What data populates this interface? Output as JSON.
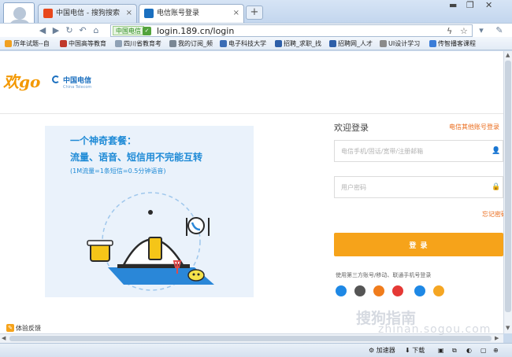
{
  "browser": {
    "tabs": [
      {
        "label": "中国电信 - 搜狗搜索",
        "active": false
      },
      {
        "label": "电信账号登录",
        "active": true
      }
    ],
    "new_tab": "+",
    "address": "login.189.cn/login",
    "cert_label": "中国电信",
    "bookmarks": [
      "历年试题--自",
      "中国高等教育",
      "四川省教育考",
      "我的订阅_频",
      "电子科技大学",
      "招聘_求职_找",
      "招聘网_人才",
      "UI设计学习",
      "传智播客课程"
    ],
    "status": {
      "accelerator": "加速器",
      "download": "下载"
    }
  },
  "page": {
    "logo": "欢go",
    "telecom_logo": "中国电信",
    "telecom_sub": "China Telecom",
    "banner": {
      "line1": "一个神奇套餐：",
      "line2": "流量、语音、短信用不完能互转",
      "line3": "(1M流量=1条短信=0.5分钟语音)"
    },
    "login": {
      "title": "欢迎登录",
      "other_login": "电信其他账号登录",
      "account_placeholder": "电信手机/固话/宽带/注册邮箱",
      "password_placeholder": "用户密码",
      "forgot": "忘记密码",
      "submit": "登 录",
      "third_party_title": "使用第三方账号/移动、联通手机号登录",
      "third_party_colors": [
        "#1e88e5",
        "#555555",
        "#f07c1c",
        "#e53935",
        "#1e88e5",
        "#f5a623"
      ]
    },
    "feedback": "体验反馈"
  },
  "watermark": {
    "text": "搜狗指南",
    "domain": "zhinan.sogou.com"
  }
}
